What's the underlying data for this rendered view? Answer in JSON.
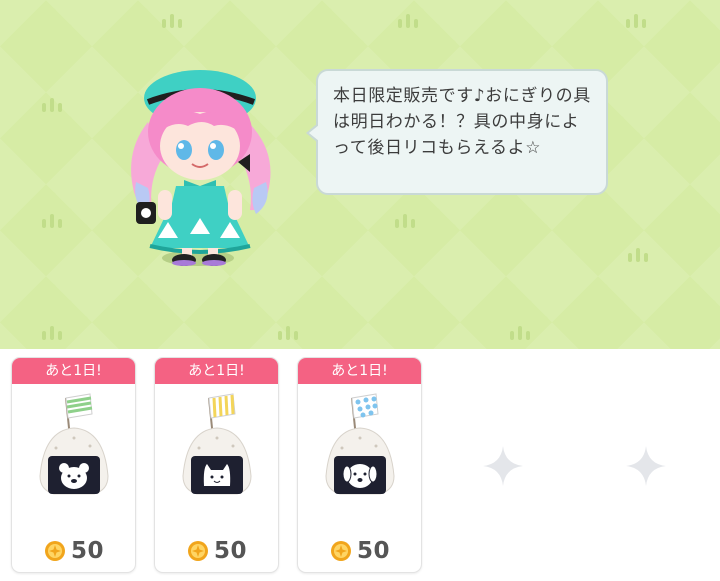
{
  "npc": {
    "message": "本日限定販売です♪おにぎりの具は明日わかる！？具の中身によって後日リコもらえるよ☆"
  },
  "shop": {
    "items": [
      {
        "tag": "あと1日!",
        "price": "50",
        "icon": "onigiri-bear-icon"
      },
      {
        "tag": "あと1日!",
        "price": "50",
        "icon": "onigiri-cat-icon"
      },
      {
        "tag": "あと1日!",
        "price": "50",
        "icon": "onigiri-dog-icon"
      }
    ],
    "empty_slots": [
      "sparkle-icon",
      "sparkle-icon"
    ]
  },
  "colors": {
    "background": "#d6eca5",
    "tag": "#f46283",
    "coin": "#f1a51c",
    "price": "#555555"
  }
}
